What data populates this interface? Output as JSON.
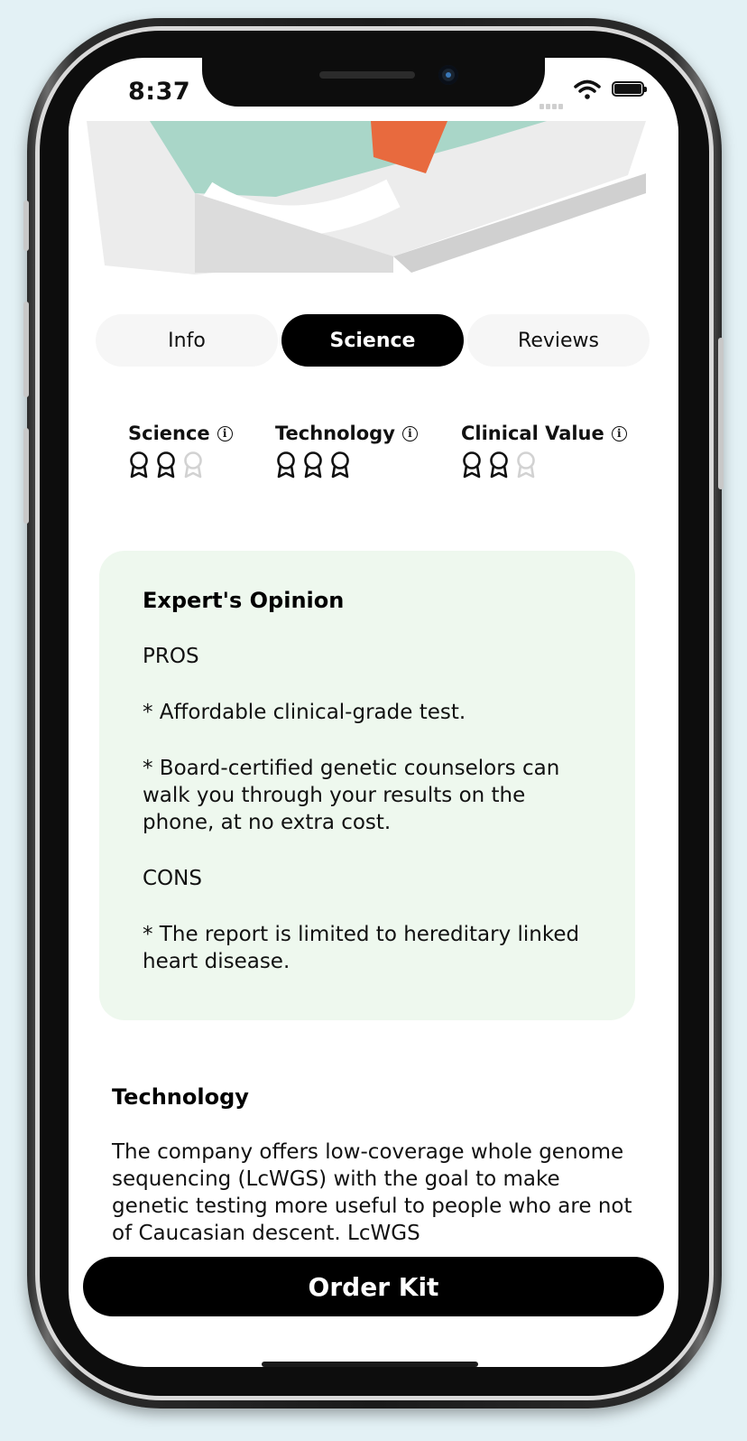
{
  "status_bar": {
    "time": "8:37",
    "icons": [
      "signal-icon",
      "wifi-icon",
      "battery-icon"
    ]
  },
  "tabs": [
    {
      "label": "Info",
      "active": false
    },
    {
      "label": "Science",
      "active": true
    },
    {
      "label": "Reviews",
      "active": false
    }
  ],
  "ratings": [
    {
      "label": "Science",
      "filled": 2,
      "total": 3
    },
    {
      "label": "Technology",
      "filled": 3,
      "total": 3
    },
    {
      "label": "Clinical Value",
      "filled": 2,
      "total": 3
    }
  ],
  "expert_opinion": {
    "title": "Expert's Opinion",
    "pros_heading": "PROS",
    "pro_1": "* Affordable clinical-grade test.",
    "pro_2": "* Board-certified genetic counselors can walk you through your results on the phone, at no extra cost.",
    "cons_heading": "CONS",
    "con_1": "* The report is limited to hereditary linked heart disease."
  },
  "technology": {
    "title": "Technology",
    "body": "The company offers low-coverage whole genome sequencing (LcWGS) with the goal to make genetic testing more useful to people who are not of Caucasian descent. LcWGS"
  },
  "order_button": {
    "label": "Order Kit"
  },
  "colors": {
    "background": "#e3f1f5",
    "expert_card": "#eef8ee",
    "active_tab": "#000000",
    "inactive_tab": "#f6f6f6",
    "badge_filled": "#111111",
    "badge_empty": "#d2d2d2",
    "kit_teal": "#a9d6c8",
    "kit_orange": "#e86a3e"
  }
}
